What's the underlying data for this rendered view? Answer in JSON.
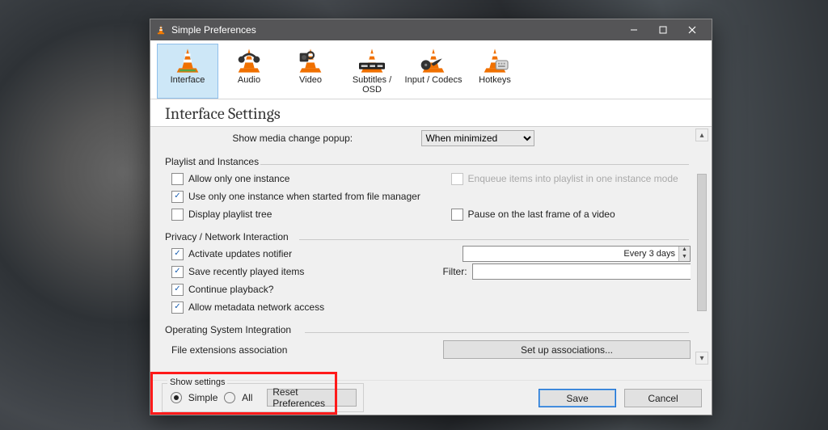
{
  "window": {
    "title": "Simple Preferences"
  },
  "tabs": [
    {
      "label": "Interface"
    },
    {
      "label": "Audio"
    },
    {
      "label": "Video"
    },
    {
      "label": "Subtitles / OSD"
    },
    {
      "label": "Input / Codecs"
    },
    {
      "label": "Hotkeys"
    }
  ],
  "page_heading": "Interface Settings",
  "top": {
    "media_change_label": "Show media change popup:",
    "media_change_value": "When minimized"
  },
  "groups": {
    "playlist": {
      "title": "Playlist and Instances",
      "allow_one": "Allow only one instance",
      "enqueue": "Enqueue items into playlist in one instance mode",
      "use_one_fm": "Use only one instance when started from file manager",
      "display_tree": "Display playlist tree",
      "pause_last": "Pause on the last frame of a video"
    },
    "privacy": {
      "title": "Privacy / Network Interaction",
      "activate_updates": "Activate updates notifier",
      "updates_value": "Every 3 days",
      "save_recent": "Save recently played items",
      "filter_label": "Filter:",
      "continue_playback": "Continue playback?",
      "allow_meta": "Allow metadata network access"
    },
    "os": {
      "title": "Operating System Integration",
      "file_assoc_label": "File extensions association",
      "file_assoc_btn": "Set up associations..."
    }
  },
  "footer": {
    "show_settings_label": "Show settings",
    "simple": "Simple",
    "all": "All",
    "reset": "Reset Preferences",
    "save": "Save",
    "cancel": "Cancel"
  }
}
